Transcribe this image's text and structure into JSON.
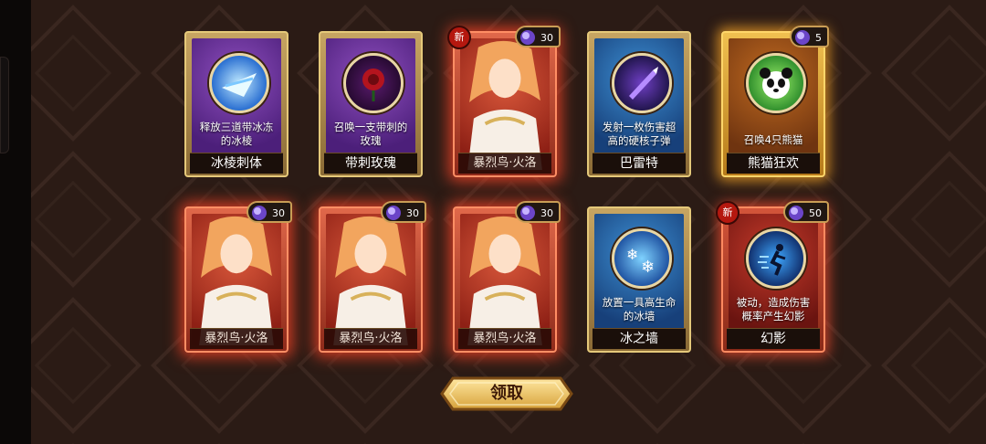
{
  "cards": [
    {
      "id": "c1",
      "type": "skill",
      "name": "冰棱刺体",
      "desc": "释放三道带冰冻的冰棱",
      "icon": "ice-shard-icon",
      "style": "purple"
    },
    {
      "id": "c2",
      "type": "skill",
      "name": "带刺玫瑰",
      "desc": "召唤一支带刺的玫瑰",
      "icon": "rose-icon",
      "style": "purple"
    },
    {
      "id": "c3",
      "type": "hero",
      "name": "暴烈鸟·火洛",
      "new": "新",
      "cost": "30"
    },
    {
      "id": "c4",
      "type": "skill",
      "name": "巴雷特",
      "desc": "发射一枚伤害超高的硬核子弹",
      "icon": "bullet-icon",
      "style": "blue"
    },
    {
      "id": "c5",
      "type": "skill",
      "name": "熊猫狂欢",
      "desc": "召唤4只熊猫",
      "icon": "panda-icon",
      "style": "gold",
      "cost": "5"
    },
    {
      "id": "c6",
      "type": "hero",
      "name": "暴烈鸟·火洛",
      "cost": "30"
    },
    {
      "id": "c7",
      "type": "hero",
      "name": "暴烈鸟·火洛",
      "cost": "30"
    },
    {
      "id": "c8",
      "type": "hero",
      "name": "暴烈鸟·火洛",
      "cost": "30"
    },
    {
      "id": "c9",
      "type": "skill",
      "name": "冰之墙",
      "desc": "放置一具高生命的冰墙",
      "icon": "ice-wall-icon",
      "style": "blue"
    },
    {
      "id": "c10",
      "type": "skill",
      "name": "幻影",
      "desc": "被动，造成伤害概率产生幻影",
      "icon": "phantom-runner-icon",
      "style": "red",
      "new": "新",
      "cost": "50"
    }
  ],
  "claim_button": {
    "label": "领取"
  },
  "colors": {
    "background": "#2a1a14",
    "gold": "#e5c97a",
    "hero_glow": "#ff5030"
  }
}
